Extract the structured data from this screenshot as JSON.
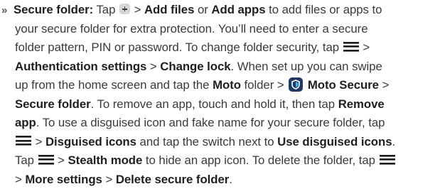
{
  "paragraph": {
    "bullet": "»",
    "l1": {
      "t1": "Secure folder:",
      "t2": " Tap ",
      "t3": " > ",
      "t4": "Add files",
      "t5": " or ",
      "t6": "Add apps",
      "t7": " to add files or apps to"
    },
    "l2": "your secure folder for extra protection. You’ll need to enter a secure",
    "l3": {
      "t1": "folder pattern, PIN or password. To change folder security, tap ",
      "t2": " >"
    },
    "l4": {
      "t1": "Authentication settings",
      "t2": " > ",
      "t3": "Change lock",
      "t4": ". When set up you can swipe"
    },
    "l5": {
      "t1": "up from the home screen and tap the ",
      "t2": "Moto",
      "t3": " folder > ",
      "t4": " Moto Secure",
      "t5": " >"
    },
    "l6": {
      "t1": "Secure folder",
      "t2": ". To remove an app, touch and hold it, then tap ",
      "t3": "Remove"
    },
    "l7": {
      "t1": "app",
      "t2": ". To use a disguised icon and fake name for your secure folder, tap"
    },
    "l8": {
      "t1": " > ",
      "t2": "Disguised icons",
      "t3": " and tap the switch next to ",
      "t4": "Use disguised icons",
      "t5": "."
    },
    "l9": {
      "t1": "Tap ",
      "t2": " > ",
      "t3": "Stealth mode",
      "t4": " to hide an app icon. To delete the folder, tap "
    },
    "l10": {
      "t1": "> ",
      "t2": "More settings",
      "t3": " > ",
      "t4": "Delete secure folder",
      "t5": "."
    }
  },
  "icons": {
    "plus": "plus-icon",
    "menu": "menu-icon",
    "moto_secure": "shield-icon",
    "moto_secure_color": "#1e3a66"
  }
}
